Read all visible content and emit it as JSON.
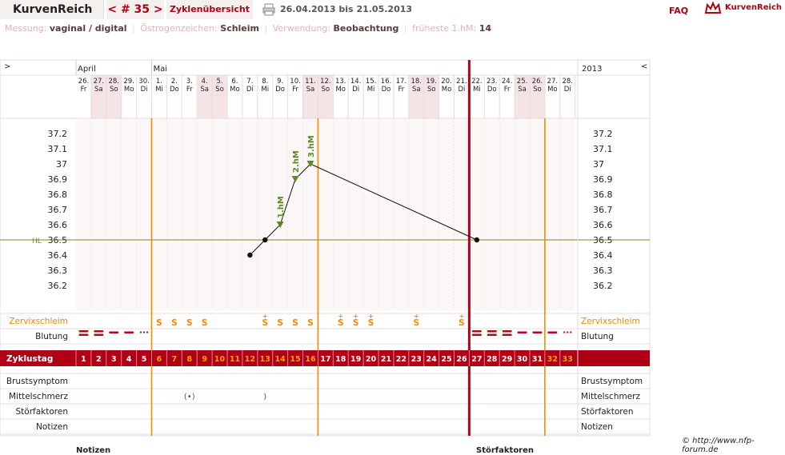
{
  "header": {
    "app_title": "KurvenReich",
    "cycle_nav": "< # 35 >",
    "cycle_overview": "Zyklenübersicht",
    "date_range": "26.04.2013 bis 21.05.2013",
    "faq": "FAQ",
    "logo_text": "KurvenReich"
  },
  "info": {
    "measurement_label": "Messung:",
    "measurement_value": "vaginal / digital",
    "estrogen_label": "Östrogenzeichen:",
    "estrogen_value": "Schleim",
    "usage_label": "Verwendung:",
    "usage_value": "Beobachtung",
    "earliest_label": "früheste 1.hM:",
    "earliest_value": "14"
  },
  "nav": {
    "left_arrow": ">",
    "right_arrow": "<",
    "year": "2013"
  },
  "months": [
    {
      "day_index": 0,
      "label": "April"
    },
    {
      "day_index": 5,
      "label": "Mai"
    }
  ],
  "days": [
    {
      "date": "26.",
      "wd": "Fr",
      "cycle": "1",
      "weekend": false
    },
    {
      "date": "27.",
      "wd": "Sa",
      "cycle": "2",
      "weekend": true
    },
    {
      "date": "28.",
      "wd": "So",
      "cycle": "3",
      "weekend": true
    },
    {
      "date": "29.",
      "wd": "Mo",
      "cycle": "4",
      "weekend": false
    },
    {
      "date": "30.",
      "wd": "Di",
      "cycle": "5",
      "weekend": false
    },
    {
      "date": "1.",
      "wd": "Mi",
      "cycle": "6",
      "weekend": false
    },
    {
      "date": "2.",
      "wd": "Do",
      "cycle": "7",
      "weekend": false
    },
    {
      "date": "3.",
      "wd": "Fr",
      "cycle": "8",
      "weekend": false
    },
    {
      "date": "4.",
      "wd": "Sa",
      "cycle": "9",
      "weekend": true
    },
    {
      "date": "5.",
      "wd": "So",
      "cycle": "10",
      "weekend": true
    },
    {
      "date": "6.",
      "wd": "Mo",
      "cycle": "11",
      "weekend": false
    },
    {
      "date": "7.",
      "wd": "Di",
      "cycle": "12",
      "weekend": false
    },
    {
      "date": "8.",
      "wd": "Mi",
      "cycle": "13",
      "weekend": false
    },
    {
      "date": "9.",
      "wd": "Do",
      "cycle": "14",
      "weekend": false
    },
    {
      "date": "10.",
      "wd": "Fr",
      "cycle": "15",
      "weekend": false
    },
    {
      "date": "11.",
      "wd": "Sa",
      "cycle": "16",
      "weekend": true
    },
    {
      "date": "12.",
      "wd": "So",
      "cycle": "17",
      "weekend": true
    },
    {
      "date": "13.",
      "wd": "Mo",
      "cycle": "18",
      "weekend": false
    },
    {
      "date": "14.",
      "wd": "Di",
      "cycle": "19",
      "weekend": false
    },
    {
      "date": "15.",
      "wd": "Mi",
      "cycle": "20",
      "weekend": false
    },
    {
      "date": "16.",
      "wd": "Do",
      "cycle": "21",
      "weekend": false
    },
    {
      "date": "17.",
      "wd": "Fr",
      "cycle": "22",
      "weekend": false
    },
    {
      "date": "18.",
      "wd": "Sa",
      "cycle": "23",
      "weekend": true
    },
    {
      "date": "19.",
      "wd": "So",
      "cycle": "24",
      "weekend": true
    },
    {
      "date": "20.",
      "wd": "Mo",
      "cycle": "25",
      "weekend": false
    },
    {
      "date": "21.",
      "wd": "Di",
      "cycle": "26",
      "weekend": false
    },
    {
      "date": "22.",
      "wd": "Mi",
      "cycle": "27",
      "weekend": false
    },
    {
      "date": "23.",
      "wd": "Do",
      "cycle": "28",
      "weekend": false
    },
    {
      "date": "24.",
      "wd": "Fr",
      "cycle": "29",
      "weekend": false
    },
    {
      "date": "25.",
      "wd": "Sa",
      "cycle": "30",
      "weekend": true
    },
    {
      "date": "26.",
      "wd": "So",
      "cycle": "31",
      "weekend": true
    },
    {
      "date": "27.",
      "wd": "Mo",
      "cycle": "32",
      "weekend": false
    },
    {
      "date": "28.",
      "wd": "Di",
      "cycle": "33",
      "weekend": false
    }
  ],
  "row_labels": {
    "cervical": "Zervixschleim",
    "bleeding": "Blutung",
    "cycle_day": "Zyklustag",
    "breast": "Brustsymptom",
    "mittelschmerz": "Mittelschmerz",
    "disturbance": "Störfaktoren",
    "notes": "Notizen"
  },
  "chart_data": {
    "type": "line",
    "title": "",
    "xlabel": "",
    "ylabel": "",
    "ylim": [
      36.1,
      37.3
    ],
    "y_ticks": [
      "37.2",
      "37.1",
      "37",
      "36.9",
      "36.8",
      "36.7",
      "36.6",
      "36.5",
      "36.4",
      "36.3",
      "36.2"
    ],
    "hl_label": "HL",
    "hl_value": 36.5,
    "series": [
      {
        "points": [
          {
            "day": 12,
            "temp": 36.4,
            "marker": "dot"
          },
          {
            "day": 13,
            "temp": 36.5,
            "marker": "dot"
          },
          {
            "day": 14,
            "temp": 36.6,
            "marker": "triangle",
            "label": "1.hM"
          },
          {
            "day": 15,
            "temp": 36.9,
            "marker": "triangle",
            "label": "2.hM"
          },
          {
            "day": 16,
            "temp": 37.0,
            "marker": "triangle",
            "label": "3.hM"
          },
          {
            "day": 27,
            "temp": 36.5,
            "marker": "dot"
          }
        ]
      }
    ],
    "orange_vlines_days": [
      5.5,
      16.5,
      31.5
    ],
    "red_vline_day": 26.5,
    "cervical": [
      {
        "day": 6,
        "sym": "S"
      },
      {
        "day": 7,
        "sym": "S"
      },
      {
        "day": 8,
        "sym": "S"
      },
      {
        "day": 9,
        "sym": "S"
      },
      {
        "day": 13,
        "sym": "S+"
      },
      {
        "day": 14,
        "sym": "S"
      },
      {
        "day": 15,
        "sym": "S"
      },
      {
        "day": 16,
        "sym": "S"
      },
      {
        "day": 18,
        "sym": "S+"
      },
      {
        "day": 19,
        "sym": "S+"
      },
      {
        "day": 20,
        "sym": "S+"
      },
      {
        "day": 23,
        "sym": "S+"
      },
      {
        "day": 26,
        "sym": "S+"
      }
    ],
    "bleeding": [
      {
        "day": 1,
        "kind": "heavy"
      },
      {
        "day": 2,
        "kind": "heavy"
      },
      {
        "day": 3,
        "kind": "medium"
      },
      {
        "day": 4,
        "kind": "medium"
      },
      {
        "day": 5,
        "kind": "spot"
      },
      {
        "day": 27,
        "kind": "heavy"
      },
      {
        "day": 28,
        "kind": "heavy"
      },
      {
        "day": 29,
        "kind": "heavy"
      },
      {
        "day": 30,
        "kind": "medium"
      },
      {
        "day": 31,
        "kind": "medium"
      },
      {
        "day": 32,
        "kind": "medium"
      },
      {
        "day": 33,
        "kind": "spot"
      }
    ],
    "mittelschmerz": [
      {
        "day": 8,
        "sym": "(•)"
      },
      {
        "day": 13,
        "sym": ")"
      }
    ],
    "highlighted_cycle_days": [
      6,
      7,
      8,
      9,
      10,
      11,
      12,
      13,
      14,
      15,
      16,
      32,
      33
    ]
  },
  "footer": {
    "copyright": "© http://www.nfp-forum.de",
    "notes_title": "Notizen",
    "disturbance_title": "Störfaktoren"
  },
  "colors": {
    "brand_red": "#b00016",
    "orange": "#f08a00",
    "weekend": "#f5e4e6",
    "grid_bg": "#fcf7f7",
    "hl_line": "#6b8e23",
    "marker_green": "#5b8a2a"
  }
}
